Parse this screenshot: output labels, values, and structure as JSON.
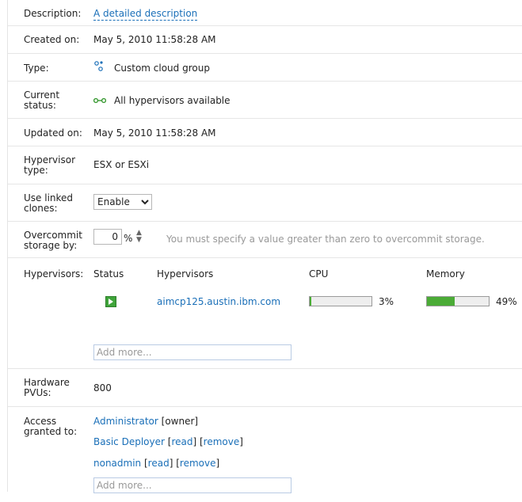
{
  "description": {
    "label": "Description:",
    "value": "A detailed description"
  },
  "created_on": {
    "label": "Created on:",
    "value": "May 5, 2010 11:58:28 AM"
  },
  "type": {
    "label": "Type:",
    "value": "Custom cloud group",
    "icon": "cloud-group-icon"
  },
  "current_status": {
    "label_line1": "Current",
    "label_line2": "status:",
    "value": "All hypervisors available",
    "icon": "hypervisor-link-icon"
  },
  "updated_on": {
    "label": "Updated on:",
    "value": "May 5, 2010 11:58:28 AM"
  },
  "hypervisor_type": {
    "label_line1": "Hypervisor",
    "label_line2": "type:",
    "value": "ESX or ESXi"
  },
  "linked_clones": {
    "label_line1": "Use linked",
    "label_line2": "clones:",
    "selected": "Enable"
  },
  "overcommit": {
    "label_line1": "Overcommit",
    "label_line2": "storage by:",
    "value": "0",
    "unit": "%",
    "hint": "You must specify a value greater than zero to overcommit storage."
  },
  "hypervisors": {
    "label": "Hypervisors:",
    "columns": {
      "status": "Status",
      "name": "Hypervisors",
      "cpu": "CPU",
      "memory": "Memory"
    },
    "rows": [
      {
        "name": "aimcp125.austin.ibm.com",
        "cpu_text": "3%",
        "cpu_fraction": 0.03,
        "memory_text": "49%",
        "memory_fraction": 0.45
      }
    ],
    "add_placeholder": "Add more..."
  },
  "hardware_pvus": {
    "label_line1": "Hardware",
    "label_line2": "PVUs:",
    "value": "800"
  },
  "access": {
    "label_line1": "Access",
    "label_line2": "granted to:",
    "entries": [
      {
        "name": "Administrator",
        "role": "[owner]"
      },
      {
        "name": "Basic Deployer",
        "role_open": "[",
        "role": "read",
        "role_close": "]",
        "remove_open": "[",
        "remove": "remove",
        "remove_close": "]"
      },
      {
        "name": "nonadmin",
        "role_open": "[",
        "role": "read",
        "role_close": "]",
        "remove_open": "[",
        "remove": "remove",
        "remove_close": "]"
      }
    ],
    "add_placeholder": "Add more..."
  },
  "colors": {
    "link": "#1a6fb8",
    "bar_fill": "#4bab36",
    "status_green": "#3fa43a"
  }
}
